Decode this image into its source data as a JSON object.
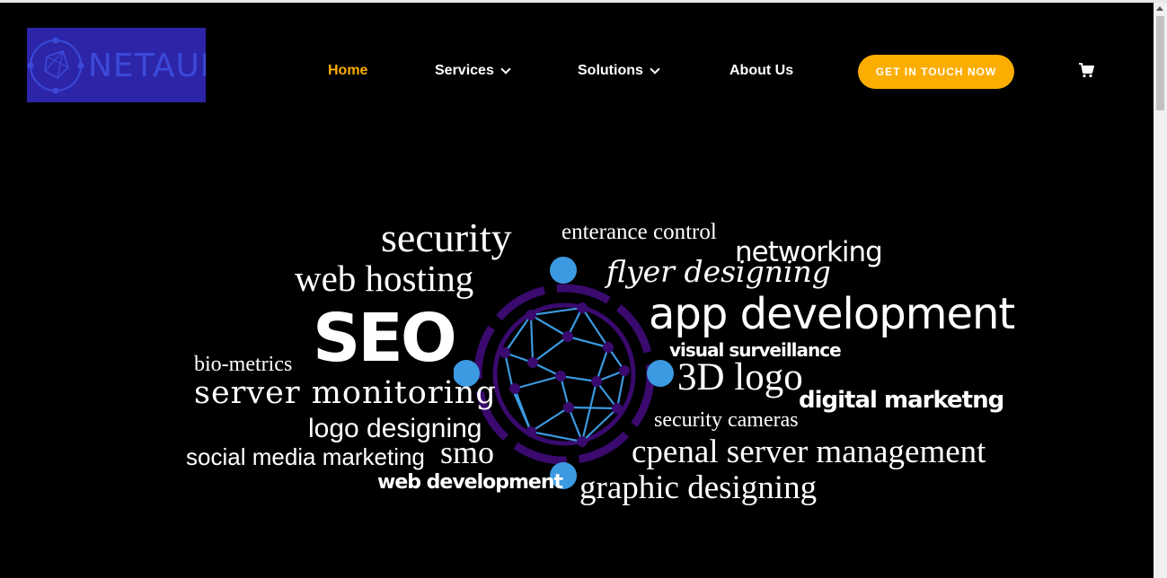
{
  "header": {
    "logo_text": "NETAUN",
    "nav": [
      {
        "label": "Home",
        "active": true,
        "has_dropdown": false
      },
      {
        "label": "Services",
        "active": false,
        "has_dropdown": true
      },
      {
        "label": "Solutions",
        "active": false,
        "has_dropdown": true
      },
      {
        "label": "About Us",
        "active": false,
        "has_dropdown": false
      }
    ],
    "cta_label": "GET IN TOUCH NOW",
    "cart_icon": "cart-icon"
  },
  "hero": {
    "graphic": "network-globe-icon",
    "words": [
      "security",
      "enterance control",
      "networking",
      "web hosting",
      "flyer designing",
      "app development",
      "SEO",
      "visual surveillance",
      "bio-metrics",
      "3D logo",
      "server monitoring",
      "digital marketng",
      "security cameras",
      "logo designing",
      "smo",
      "cpenal server management",
      "social media marketing",
      "web development",
      "graphic designing"
    ]
  },
  "colors": {
    "background": "#000000",
    "accent": "#fcad01",
    "logo_bg": "#2c25a8",
    "globe_ring": "#3a0a6e",
    "globe_node": "#3b9ae1"
  }
}
